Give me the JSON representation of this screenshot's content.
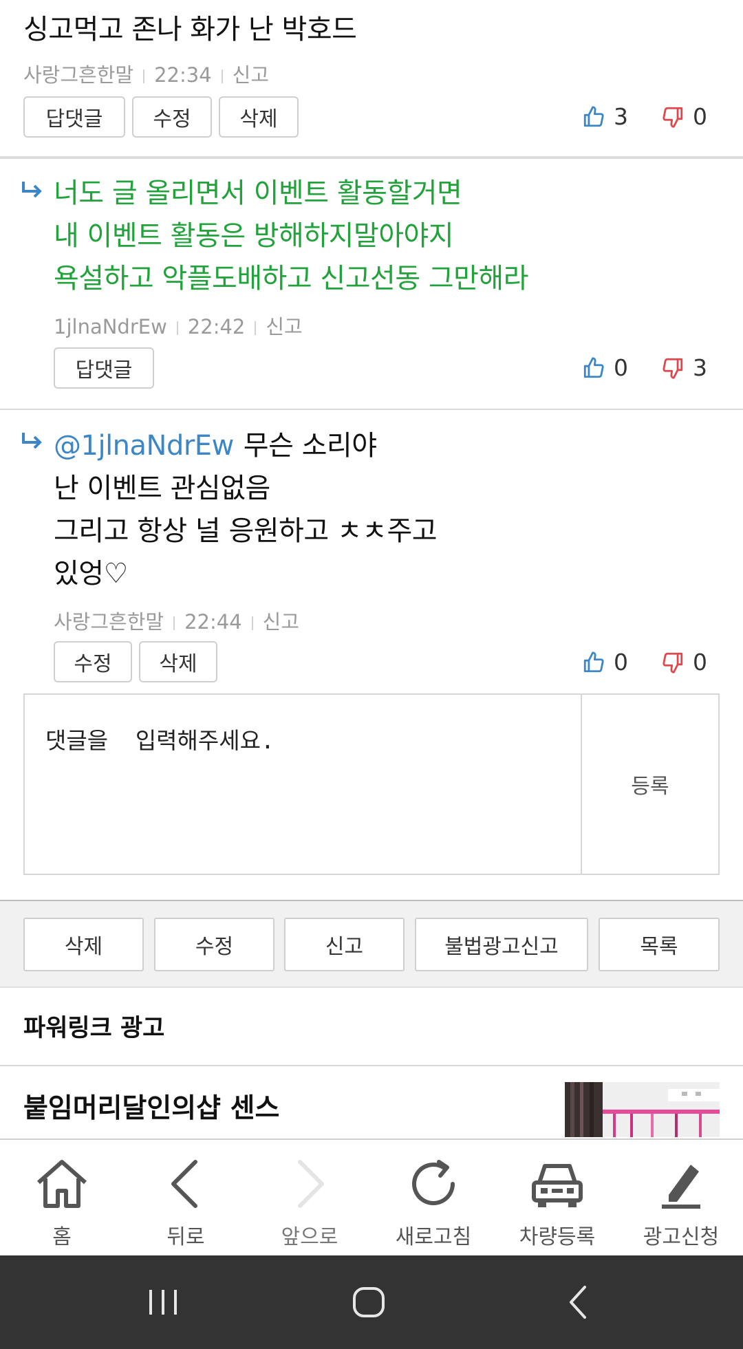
{
  "comments": [
    {
      "text": "싱고먹고 존나 화가 난 박호드",
      "author": "사랑그흔한말",
      "time": "22:34",
      "report": "신고",
      "buttons": [
        "답댓글",
        "수정",
        "삭제"
      ],
      "likes": "3",
      "dislikes": "0"
    },
    {
      "lines": [
        "너도 글 올리면서 이벤트 활동할거면",
        "내 이벤트 활동은 방해하지말아야지",
        "욕설하고 악플도배하고 신고선동 그만해라"
      ],
      "author": "1jlnaNdrEw",
      "time": "22:42",
      "report": "신고",
      "buttons": [
        "답댓글"
      ],
      "likes": "0",
      "dislikes": "3",
      "text_color": "#22a23a"
    },
    {
      "mention": "@1jlnaNdrEw",
      "lines": [
        "무슨 소리야",
        "난 이벤트 관심없음",
        "그리고 항상 널 응원하고 ㅊㅊ주고",
        "있엉♡"
      ],
      "author": "사랑그흔한말",
      "time": "22:44",
      "report": "신고",
      "buttons": [
        "수정",
        "삭제"
      ],
      "likes": "0",
      "dislikes": "0"
    }
  ],
  "comment_input": {
    "placeholder": "댓글을  입력해주세요.",
    "submit": "등록"
  },
  "actions": [
    "삭제",
    "수정",
    "신고",
    "불법광고신고",
    "목록"
  ],
  "powerlink": {
    "title": "파워링크 광고",
    "ad_title": "붙임머리달인의샵 센스"
  },
  "bottom_nav": [
    {
      "label": "홈",
      "icon": "home-icon"
    },
    {
      "label": "뒤로",
      "icon": "back-icon"
    },
    {
      "label": "앞으로",
      "icon": "forward-icon"
    },
    {
      "label": "새로고침",
      "icon": "refresh-icon"
    },
    {
      "label": "차량등록",
      "icon": "car-icon"
    },
    {
      "label": "광고신청",
      "icon": "pencil-icon"
    }
  ],
  "colors": {
    "reply_text": "#22a23a",
    "mention": "#3d86c6",
    "like_icon": "#3d86c6",
    "dislike_icon": "#e0474c",
    "system_bar": "#333333"
  }
}
